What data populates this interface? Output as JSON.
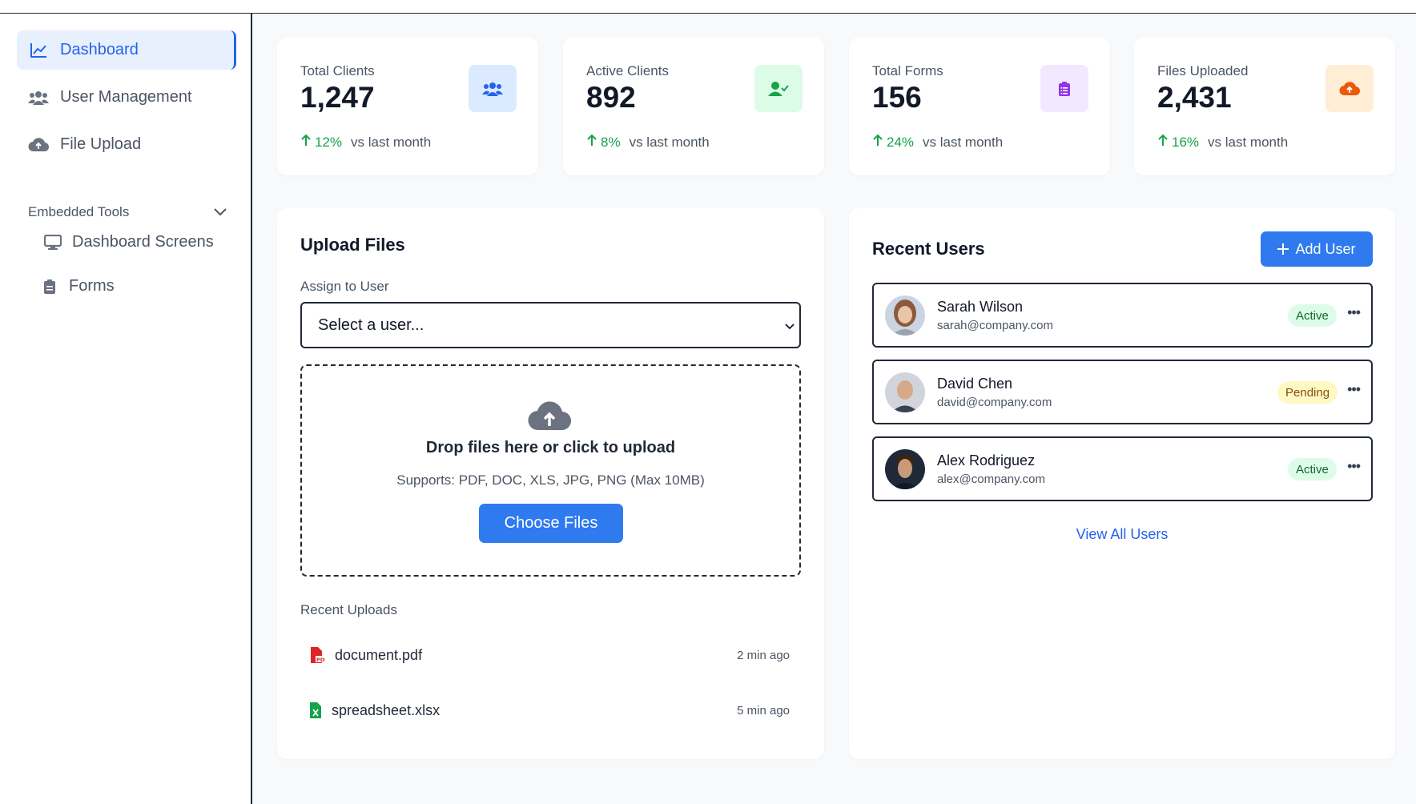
{
  "sidebar": {
    "items": [
      {
        "label": "Dashboard",
        "icon": "chart-line-icon"
      },
      {
        "label": "User Management",
        "icon": "users-icon"
      },
      {
        "label": "File Upload",
        "icon": "cloud-upload-icon"
      }
    ],
    "section": {
      "label": "Embedded Tools",
      "icon": "chevron-down-icon"
    },
    "sub_items": [
      {
        "label": "Dashboard Screens",
        "icon": "monitor-icon"
      },
      {
        "label": "Forms",
        "icon": "clipboard-icon"
      }
    ]
  },
  "stats": [
    {
      "label": "Total Clients",
      "value": "1,247",
      "delta": "12%",
      "vs": "vs last month",
      "icon": "users-icon",
      "badge_bg": "#dbeafe",
      "icon_color": "#2563eb"
    },
    {
      "label": "Active Clients",
      "value": "892",
      "delta": "8%",
      "vs": "vs last month",
      "icon": "user-check-icon",
      "badge_bg": "#dcfce7",
      "icon_color": "#16a34a"
    },
    {
      "label": "Total Forms",
      "value": "156",
      "delta": "24%",
      "vs": "vs last month",
      "icon": "clipboard-list-icon",
      "badge_bg": "#f3e8ff",
      "icon_color": "#9333ea"
    },
    {
      "label": "Files Uploaded",
      "value": "2,431",
      "delta": "16%",
      "vs": "vs last month",
      "icon": "cloud-upload-icon",
      "badge_bg": "#ffedd5",
      "icon_color": "#ea580c"
    }
  ],
  "upload": {
    "title": "Upload Files",
    "assign_label": "Assign to User",
    "select_value": "Select a user...",
    "drop_title": "Drop files here or click to upload",
    "drop_sub": "Supports: PDF, DOC, XLS, JPG, PNG (Max 10MB)",
    "choose_label": "Choose Files",
    "recent_label": "Recent Uploads",
    "recent": [
      {
        "name": "document.pdf",
        "time": "2 min ago",
        "icon": "file-pdf-icon"
      },
      {
        "name": "spreadsheet.xlsx",
        "time": "5 min ago",
        "icon": "file-excel-icon"
      }
    ]
  },
  "users": {
    "title": "Recent Users",
    "add_label": "Add User",
    "view_all": "View All Users",
    "list": [
      {
        "name": "Sarah Wilson",
        "email": "sarah@company.com",
        "status": "Active"
      },
      {
        "name": "David Chen",
        "email": "david@company.com",
        "status": "Pending"
      },
      {
        "name": "Alex Rodriguez",
        "email": "alex@company.com",
        "status": "Active"
      }
    ]
  },
  "colors": {
    "accent": "#2f7aee",
    "success": "#16a34a"
  }
}
